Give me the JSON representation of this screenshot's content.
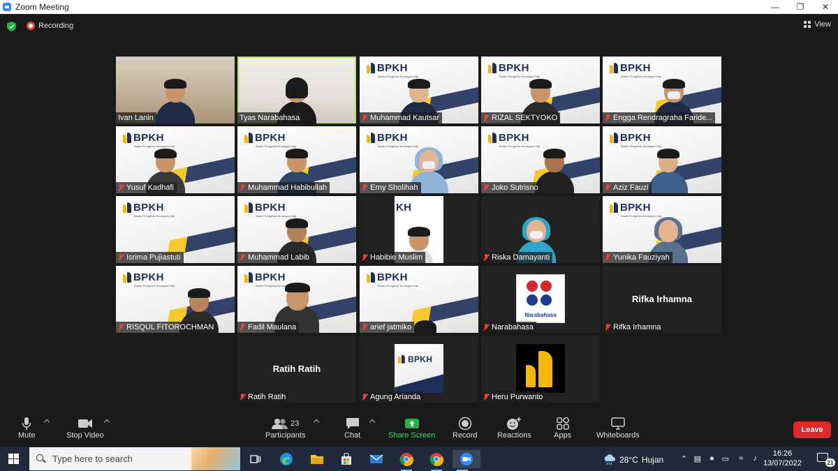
{
  "window": {
    "title": "Zoom Meeting"
  },
  "topbar": {
    "recording_label": "Recording",
    "view_label": "View"
  },
  "participants": [
    {
      "name": "Ivan Lanin",
      "muted": false,
      "bg": "room"
    },
    {
      "name": "Tyas Narabahasa",
      "muted": false,
      "bg": "room2",
      "speaking": true
    },
    {
      "name": "Muhammad Kautsar",
      "muted": true,
      "bg": "bpkh"
    },
    {
      "name": "RIZAL SEKTYOKO",
      "muted": true,
      "bg": "bpkh"
    },
    {
      "name": "Engga Rendragraha Faride...",
      "muted": true,
      "bg": "bpkh"
    },
    {
      "name": "Yusuf Kadhafi",
      "muted": true,
      "bg": "bpkh"
    },
    {
      "name": "Muhammad Habibullah",
      "muted": true,
      "bg": "bpkh"
    },
    {
      "name": "Erny Sholihah",
      "muted": true,
      "bg": "bpkh"
    },
    {
      "name": "Joko Sutrisno",
      "muted": true,
      "bg": "bpkh"
    },
    {
      "name": "Aziz Fauzi",
      "muted": true,
      "bg": "bpkh"
    },
    {
      "name": "Isrima Pujiastuti",
      "muted": true,
      "bg": "bpkh"
    },
    {
      "name": "Muhammad Labib",
      "muted": true,
      "bg": "bpkh"
    },
    {
      "name": "Habibie Muslim",
      "muted": true,
      "bg": "portrait"
    },
    {
      "name": "Riska Damayanti",
      "muted": true,
      "bg": "portrait2"
    },
    {
      "name": "Yunika Fauziyah",
      "muted": true,
      "bg": "bpkh"
    },
    {
      "name": "RISQUL FITOROCHMAN",
      "muted": true,
      "bg": "bpkh"
    },
    {
      "name": "Fadil Maulana",
      "muted": true,
      "bg": "bpkh"
    },
    {
      "name": "arief jatmiko",
      "muted": true,
      "bg": "bpkh"
    },
    {
      "name": "Narabahasa",
      "muted": true,
      "bg": "nara"
    },
    {
      "name": "Rifka Irhamna",
      "muted": true,
      "bg": "text",
      "center_text": "Rifka Irhamna"
    },
    {
      "name": "Ratih Ratih",
      "muted": true,
      "bg": "text",
      "center_text": "Ratih Ratih"
    },
    {
      "name": "Agung Arianda",
      "muted": true,
      "bg": "bpkhsmall"
    },
    {
      "name": "Heru Purwanto",
      "muted": true,
      "bg": "heru"
    }
  ],
  "logos": {
    "bpkh_word": "BPKH",
    "bpkh_sub": "Badan Pengelola Keuangan Haji",
    "bpkh_partial": "KH",
    "nara_word": "Narabahasa"
  },
  "toolbar": {
    "mute": "Mute",
    "stop_video": "Stop Video",
    "participants": "Participants",
    "participants_count": "23",
    "chat": "Chat",
    "share_screen": "Share Screen",
    "record": "Record",
    "reactions": "Reactions",
    "apps": "Apps",
    "whiteboards": "Whiteboards",
    "leave": "Leave"
  },
  "taskbar": {
    "search_placeholder": "Type here to search",
    "weather_temp": "28°C",
    "weather_text": "Hujan",
    "time": "16:26",
    "date": "13/07/2022",
    "notifications": "21"
  },
  "colors": {
    "speaking_outline": "#b8e05b",
    "leave_red": "#e02828",
    "share_green": "#3dd36a",
    "muted_red": "#e0443a"
  }
}
